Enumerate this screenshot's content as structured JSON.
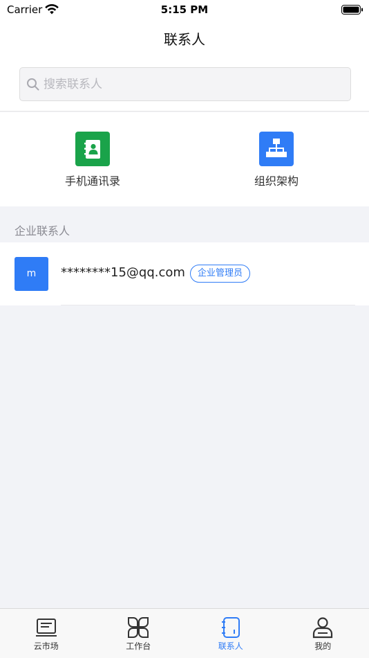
{
  "status_bar": {
    "carrier": "Carrier",
    "time": "5:15 PM"
  },
  "nav": {
    "title": "联系人"
  },
  "search": {
    "placeholder": "搜索联系人",
    "value": ""
  },
  "shortcuts": [
    {
      "label": "手机通讯录",
      "icon": "address-book-icon",
      "color": "#1aa34a"
    },
    {
      "label": "组织架构",
      "icon": "org-chart-icon",
      "color": "#2f7cf6"
    }
  ],
  "section": {
    "title": "企业联系人"
  },
  "contacts": [
    {
      "avatar_letter": "m",
      "name": "********15@qq.com",
      "role": "企业管理员",
      "avatar_color": "#2f7cf6"
    }
  ],
  "tabs": [
    {
      "label": "云市场",
      "icon": "market-icon",
      "active": false
    },
    {
      "label": "工作台",
      "icon": "workbench-icon",
      "active": false
    },
    {
      "label": "联系人",
      "icon": "contacts-icon",
      "active": true
    },
    {
      "label": "我的",
      "icon": "profile-icon",
      "active": false
    }
  ],
  "colors": {
    "accent": "#2f7cf6",
    "green": "#1aa34a",
    "background": "#f2f3f7"
  }
}
